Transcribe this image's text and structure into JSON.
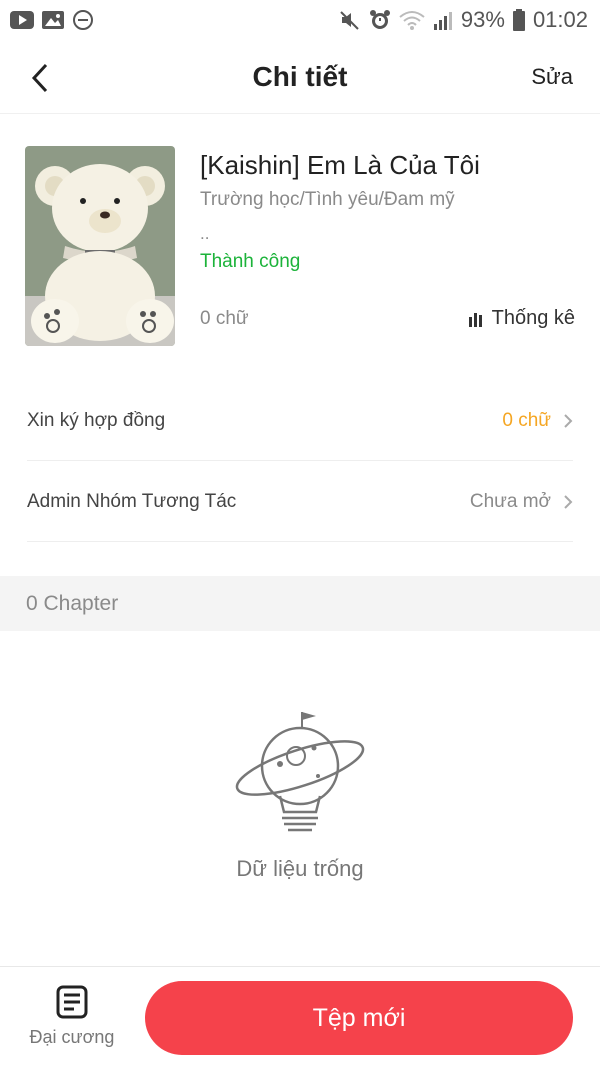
{
  "status_bar": {
    "battery": "93%",
    "time": "01:02"
  },
  "header": {
    "title": "Chi tiết",
    "edit_label": "Sửa"
  },
  "book": {
    "title": "[Kaishin] Em Là Của Tôi",
    "genres": "Trường học/Tình yêu/Đam mỹ",
    "ellipsis": "..",
    "status": "Thành công",
    "word_count": "0 chữ",
    "stats_label": "Thống kê"
  },
  "rows": [
    {
      "label": "Xin ký hợp đồng",
      "value": "0 chữ"
    },
    {
      "label": "Admin Nhóm Tương Tác",
      "value": "Chưa mở"
    }
  ],
  "chapters": {
    "count_label": "0 Chapter"
  },
  "empty_state": {
    "text": "Dữ liệu trống"
  },
  "bottom": {
    "outline_label": "Đại cương",
    "new_file_label": "Tệp mới"
  },
  "colors": {
    "accent": "#f5424b",
    "success": "#1cb33a",
    "warning": "#f5a623"
  }
}
